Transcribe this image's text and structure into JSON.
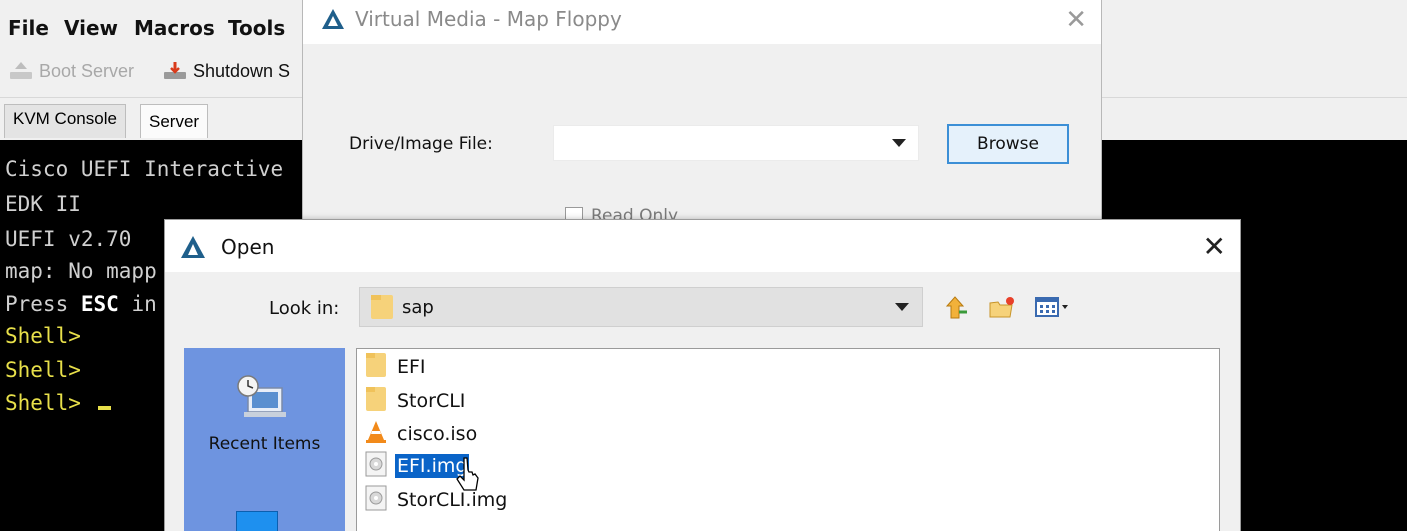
{
  "app": {
    "menu": [
      "File",
      "View",
      "Macros",
      "Tools"
    ],
    "toolbar": {
      "boot_server": "Boot Server",
      "shutdown": "Shutdown S"
    },
    "tabs": [
      "KVM Console",
      "Server"
    ]
  },
  "console": {
    "lines": [
      "Cisco UEFI Interactive",
      "EDK II",
      "UEFI v2.70",
      "map: No mapp",
      "Press ",
      "Shell>",
      "Shell>",
      "Shell> "
    ],
    "esc_word": "ESC",
    "press_tail": " in",
    "colors": {
      "background": "#000000",
      "text": "#d0d0d0",
      "prompt": "#e8e04a"
    }
  },
  "virtual_media": {
    "title": "Virtual Media - Map Floppy",
    "drive_label": "Drive/Image File:",
    "drive_value": "",
    "browse_label": "Browse",
    "read_only_label": "Read Only",
    "close_icon": "close-icon"
  },
  "open_dialog": {
    "title": "Open",
    "look_in_label": "Look in:",
    "look_in_value": "sap",
    "places": [
      {
        "label": "Recent Items",
        "icon": "recent-items-icon"
      }
    ],
    "files": [
      {
        "name": "EFI",
        "icon": "folder-icon",
        "selected": false
      },
      {
        "name": "StorCLI",
        "icon": "folder-icon",
        "selected": false
      },
      {
        "name": "cisco.iso",
        "icon": "vlc-cone-icon",
        "selected": false
      },
      {
        "name": "EFI.img",
        "icon": "disk-image-icon",
        "selected": true
      },
      {
        "name": "StorCLI.img",
        "icon": "disk-image-icon",
        "selected": false
      }
    ],
    "colors": {
      "places_bg": "#6e94e0",
      "selection": "#0a64c8"
    }
  }
}
